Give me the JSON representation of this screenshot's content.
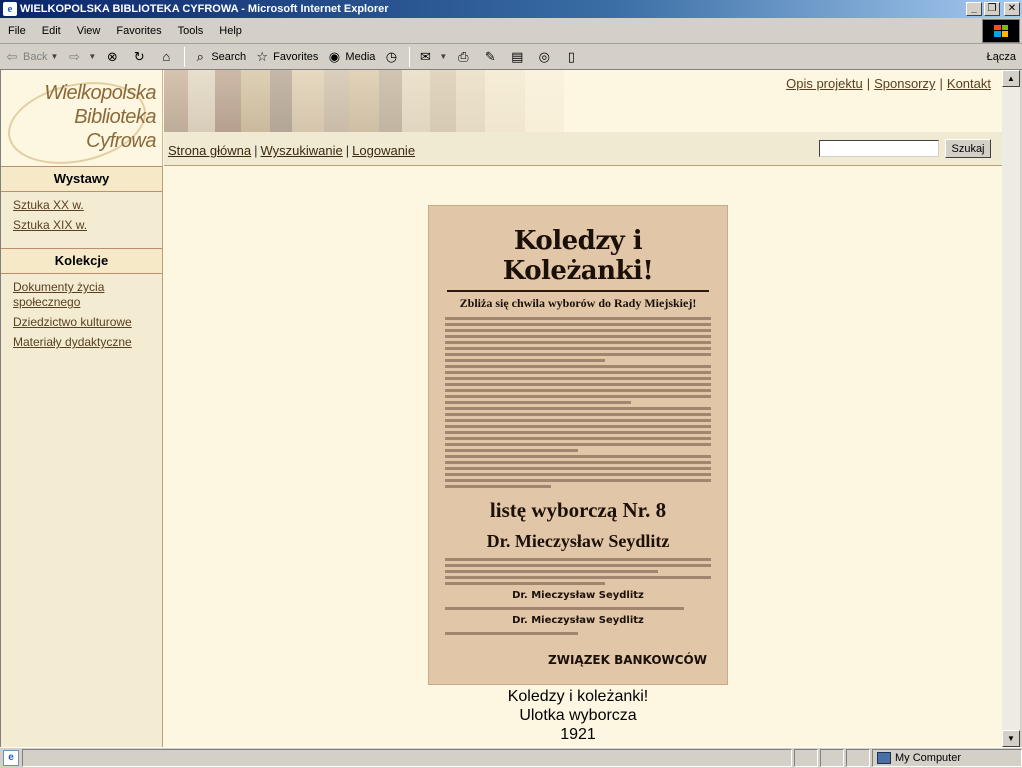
{
  "window": {
    "title": "WIELKOPOLSKA BIBLIOTEKA CYFROWA - Microsoft Internet Explorer"
  },
  "menu": [
    "File",
    "Edit",
    "View",
    "Favorites",
    "Tools",
    "Help"
  ],
  "toolbar": {
    "back": "Back",
    "search": "Search",
    "favorites": "Favorites",
    "media": "Media",
    "links": "Łącza"
  },
  "site": {
    "logo": [
      "Wielkopolska",
      "Biblioteka",
      "Cyfrowa"
    ],
    "top_links": [
      "Opis projektu",
      "Sponsorzy",
      "Kontakt"
    ],
    "nav_links": [
      "Strona główna",
      "Wyszukiwanie",
      "Logowanie"
    ],
    "search_button": "Szukaj",
    "search_value": ""
  },
  "sidebar": {
    "sections": [
      {
        "title": "Wystawy",
        "items": [
          "Sztuka XX w.",
          "Sztuka XIX w."
        ]
      },
      {
        "title": "Kolekcje",
        "items": [
          "Dokumenty życia społecznego",
          "Dziedzictwo kulturowe",
          "Materiały dydaktyczne"
        ]
      }
    ]
  },
  "poster": {
    "headline": "Koledzy i Koleżanki!",
    "subheadline": "Zbliża się chwila wyborów do Rady Miejskiej!",
    "list": "listę wyborczą Nr. 8",
    "candidate": "Dr. Mieczysław Seydlitz",
    "candidate_small": "Dr. Mieczysław Seydlitz",
    "signature": "ZWIĄZEK BANKOWCÓW"
  },
  "caption": [
    "Koledzy i koleżanki!",
    "Ulotka wyborcza",
    "1921"
  ],
  "status": {
    "zone": "My Computer"
  }
}
